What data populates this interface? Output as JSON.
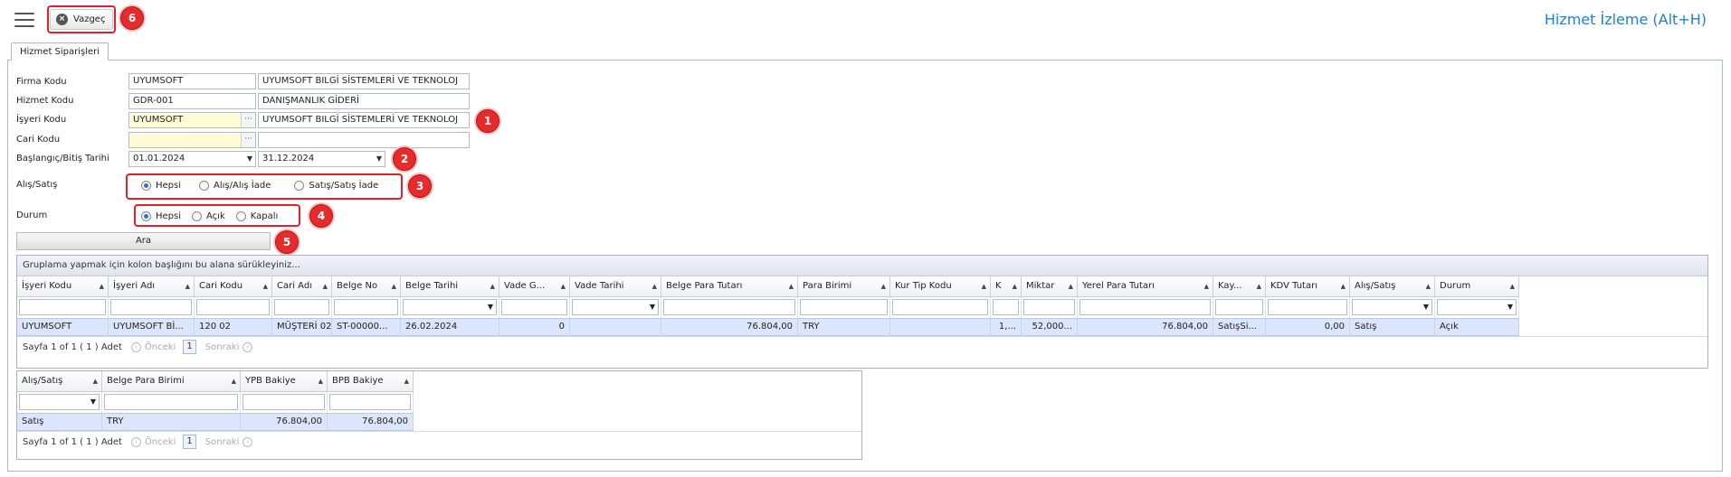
{
  "header": {
    "cancel_label": "Vazgeç",
    "page_title": "Hizmet İzleme (Alt+H)"
  },
  "tab": {
    "label": "Hizmet Siparişleri"
  },
  "form": {
    "firma_kodu": {
      "label": "Firma Kodu",
      "value": "UYUMSOFT",
      "desc": "UYUMSOFT BILGİ SİSTEMLERİ VE TEKNOLOJ"
    },
    "hizmet_kodu": {
      "label": "Hizmet Kodu",
      "value": "GDR-001",
      "desc": "DANIŞMANLIK GİDERİ"
    },
    "isyeri_kodu": {
      "label": "İşyeri Kodu",
      "value": "UYUMSOFT",
      "desc": "UYUMSOFT BILGİ SİSTEMLERİ VE TEKNOLOJ"
    },
    "cari_kodu": {
      "label": "Cari Kodu",
      "value": "",
      "desc": ""
    },
    "tarih": {
      "label": "Başlangıç/Bitiş Tarihi",
      "start": "01.01.2024",
      "end": "31.12.2024"
    },
    "alis_satis": {
      "label": "Alış/Satış",
      "options": [
        "Hepsi",
        "Alış/Alış İade",
        "Satış/Satış İade"
      ],
      "selected": 0
    },
    "durum": {
      "label": "Durum",
      "options": [
        "Hepsi",
        "Açık",
        "Kapalı"
      ],
      "selected": 0
    },
    "search_label": "Ara"
  },
  "badges": [
    "1",
    "2",
    "3",
    "4",
    "5",
    "6"
  ],
  "grid1": {
    "group_hint": "Gruplama yapmak için kolon başlığını bu alana sürükleyiniz...",
    "columns": [
      "İşyeri Kodu",
      "İşyeri Adı",
      "Cari Kodu",
      "Cari Adı",
      "Belge No",
      "Belge Tarihi",
      "Vade G...",
      "Vade Tarihi",
      "Belge Para Tutarı",
      "Para Birimi",
      "Kur Tip Kodu",
      "K",
      "Miktar",
      "Yerel Para Tutarı",
      "Kay...",
      "KDV Tutarı",
      "Alış/Satış",
      "Durum"
    ],
    "row": [
      "UYUMSOFT",
      "UYUMSOFT Bİ...",
      "120 02",
      "MÜŞTERİ 02",
      "ST-00000...",
      "26.02.2024",
      "0",
      "",
      "76.804,00",
      "TRY",
      "",
      "1,...",
      "52,000...",
      "76.804,00",
      "SatışSi...",
      "0,00",
      "Satış",
      "Açık"
    ],
    "pager": {
      "text": "Sayfa 1 of 1 ( 1 ) Adet",
      "prev": "Önceki",
      "page": "1",
      "next": "Sonraki"
    }
  },
  "grid2": {
    "columns": [
      "Alış/Satış",
      "Belge Para Birimi",
      "YPB Bakiye",
      "BPB Bakiye"
    ],
    "row": [
      "Satış",
      "TRY",
      "76.804,00",
      "76.804,00"
    ],
    "pager": {
      "text": "Sayfa 1 of 1 ( 1 ) Adet",
      "prev": "Önceki",
      "page": "1",
      "next": "Sonraki"
    }
  }
}
